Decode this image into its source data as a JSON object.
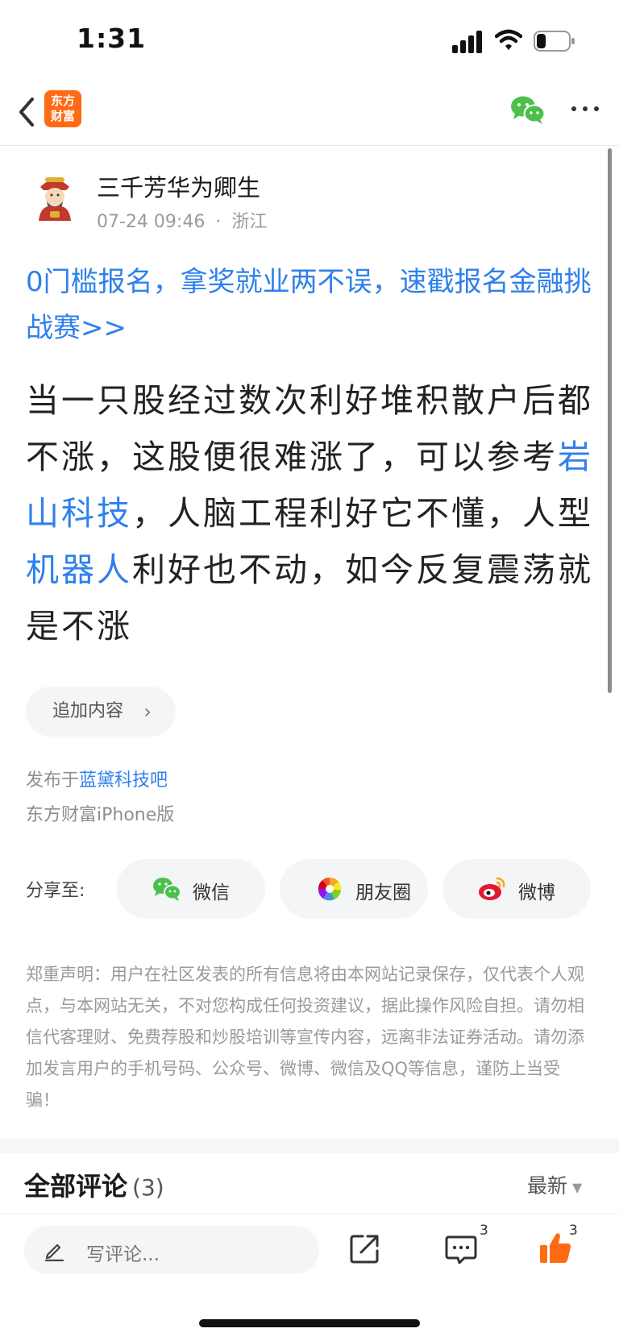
{
  "status_bar": {
    "time": "1:31",
    "battery_level": 0.3
  },
  "nav": {
    "app_logo_line1": "东方",
    "app_logo_line2": "财富"
  },
  "author": {
    "name": "三千芳华为卿生",
    "date": "07-24 09:46",
    "location": "浙江",
    "separator": "·"
  },
  "promo": {
    "text": "0门槛报名，拿奖就业两不误，速戳报名金融挑战赛>>"
  },
  "post": {
    "part1": "当一只股经过数次利好堆积散户后都不涨，这股便很难涨了，可以参考",
    "stock1": "岩山科技",
    "part2": "，人脑工程利好它不懂，人型",
    "stock2": "机器人",
    "part3": "利好也不动，如今反复震荡就是不涨"
  },
  "append": {
    "label": "追加内容"
  },
  "published": {
    "prefix": "发布于",
    "bar": "蓝黛科技吧"
  },
  "client": {
    "text": "东方财富iPhone版"
  },
  "share": {
    "label": "分享至:",
    "wechat": "微信",
    "moments": "朋友圈",
    "weibo": "微博"
  },
  "disclaimer": {
    "text": "郑重声明：用户在社区发表的所有信息将由本网站记录保存，仅代表个人观点，与本网站无关，不对您构成任何投资建议，据此操作风险自担。请勿相信代客理财、免费荐股和炒股培训等宣传内容，远离非法证券活动。请勿添加发言用户的手机号码、公众号、微博、微信及QQ等信息，谨防上当受骗！"
  },
  "comments": {
    "title": "全部评论",
    "count": "(3)",
    "sort_label": "最新"
  },
  "bottom_bar": {
    "placeholder": "写评论...",
    "comment_count": "3",
    "like_count": "3"
  },
  "colors": {
    "link": "#2f80ed",
    "brand": "#ff6a14",
    "like": "#ff6a14",
    "wechat": "#4cc04c",
    "weibo": "#e6162d"
  }
}
